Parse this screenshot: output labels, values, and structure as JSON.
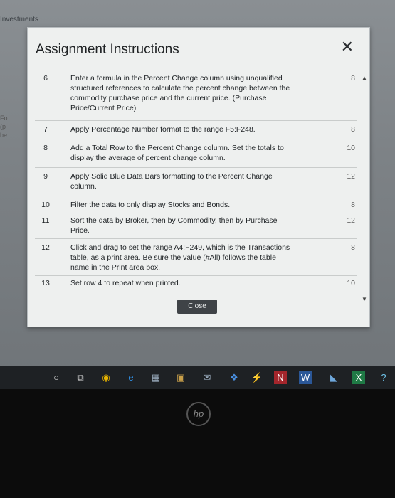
{
  "app": {
    "title": "Investments"
  },
  "background_text": [
    "Fo",
    "(p",
    "be"
  ],
  "dialog": {
    "title": "Assignment Instructions",
    "close_icon": "✕",
    "close_label": "Close",
    "tasks": [
      {
        "num": "6",
        "text": "Enter a formula in the Percent Change column using unqualified structured references to calculate the percent change between the commodity purchase price and the current price. (Purchase Price/Current Price)",
        "points": "8"
      },
      {
        "num": "7",
        "text": "Apply Percentage Number format to the range F5:F248.",
        "points": "8"
      },
      {
        "num": "8",
        "text": "Add a Total Row to the Percent Change column. Set the totals to display the average of percent change column.",
        "points": "10"
      },
      {
        "num": "9",
        "text": "Apply Solid Blue Data Bars formatting to the Percent Change column.",
        "points": "12"
      },
      {
        "num": "10",
        "text": "Filter the data to only display Stocks and Bonds.",
        "points": "8"
      },
      {
        "num": "11",
        "text": "Sort the data by Broker, then by Commodity, then by Purchase Price.",
        "points": "12"
      },
      {
        "num": "12",
        "text": "Click and drag to set the range A4:F249, which is the Transactions table, as a print area. Be sure the value (#All) follows the table name in the Print area box.",
        "points": "8"
      },
      {
        "num": "13",
        "text": "Set row 4 to repeat when printed.",
        "points": "10"
      }
    ]
  },
  "taskbar": {
    "icons": [
      "start-icon",
      "task-view-icon",
      "chrome-icon",
      "edge-icon",
      "store-icon",
      "briefcase-icon",
      "mail-icon",
      "dropbox-icon",
      "sway-icon",
      "onenote-icon",
      "word-icon",
      "photos-icon",
      "excel-icon",
      "help-icon"
    ]
  },
  "bezel": {
    "logo": "hp"
  }
}
